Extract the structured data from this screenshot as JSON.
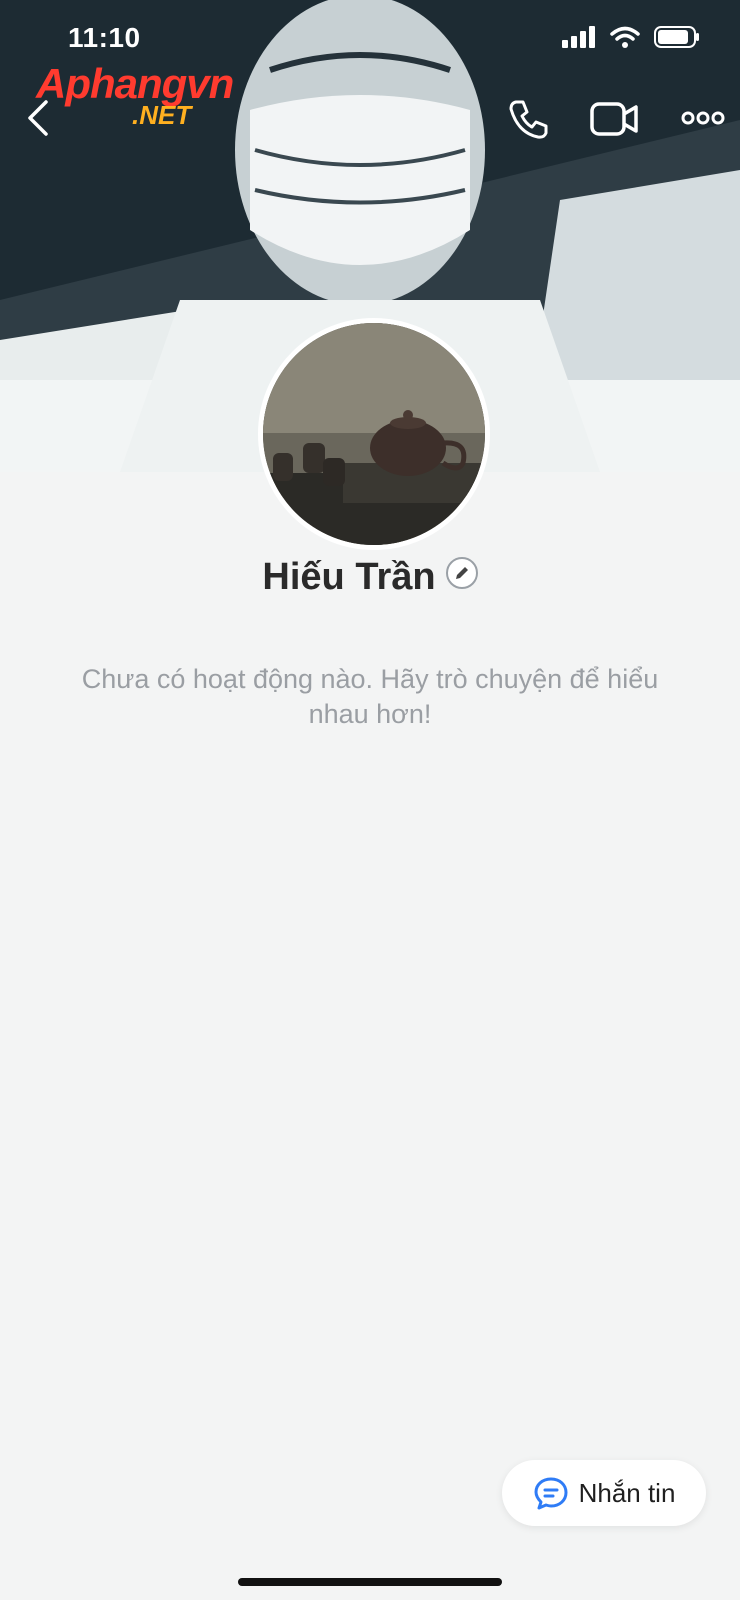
{
  "status_bar": {
    "time": "11:10"
  },
  "watermark": {
    "main": "Aphangvn",
    "sub": ".NET"
  },
  "header": {
    "icons": [
      "chevron-left-icon",
      "phone-icon",
      "video-camera-icon",
      "more-icon"
    ]
  },
  "profile": {
    "name": "Hiếu Trần",
    "empty_message": "Chưa có hoạt động nào. Hãy trò chuyện để hiểu nhau hơn!"
  },
  "actions": {
    "message_label": "Nhắn tin"
  },
  "colors": {
    "background": "#f3f4f4",
    "accent": "#2f7cf6"
  }
}
